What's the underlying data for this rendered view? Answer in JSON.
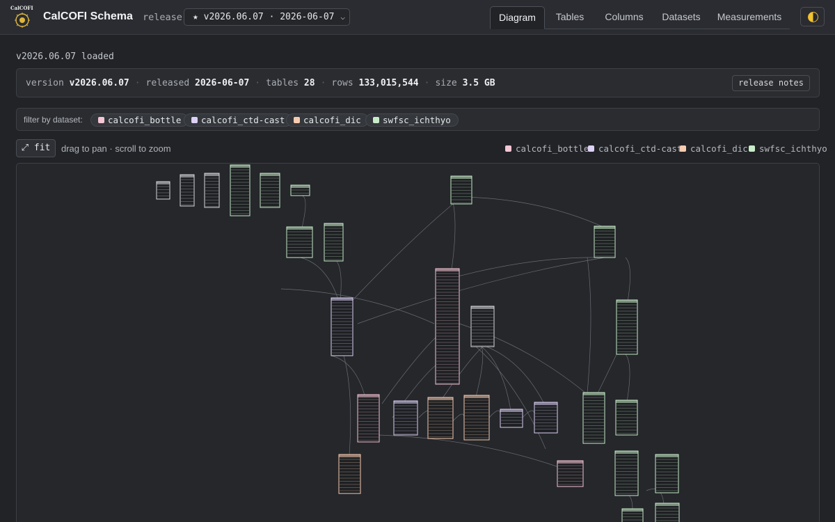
{
  "header": {
    "logo_text": "CalCOFI",
    "title": "CalCOFI Schema",
    "release_label": "release",
    "release_selected": "★ v2026.06.07 · 2026-06-07",
    "tabs": [
      "Diagram",
      "Tables",
      "Columns",
      "Datasets",
      "Measurements"
    ],
    "active_tab": "Diagram"
  },
  "status": "v2026.06.07 loaded",
  "summary": {
    "version_label": "version",
    "version": "v2026.06.07",
    "released_label": "released",
    "released": "2026-06-07",
    "tables_label": "tables",
    "tables": "28",
    "rows_label": "rows",
    "rows": "133,015,544",
    "size_label": "size",
    "size": "3.5 GB",
    "notes_button": "release notes"
  },
  "filter": {
    "label": "filter by dataset:",
    "datasets": [
      "calcofi_bottle",
      "calcofi_ctd-cast",
      "calcofi_dic",
      "swfsc_ichthyo"
    ]
  },
  "toolbar": {
    "fit_label": "⤢ fit",
    "hint": "drag to pan · scroll to zoom"
  },
  "legend": [
    "calcofi_bottle",
    "calcofi_ctd-cast",
    "calcofi_dic",
    "swfsc_ichthyo"
  ],
  "colors": {
    "calcofi_bottle": "#f5c6d4",
    "calcofi_ctd-cast": "#ddd0f5",
    "calcofi_dic": "#f8cbb0",
    "swfsc_ichthyo": "#c8ecc8",
    "neutral": "#d8dade",
    "accent": "#f4c430"
  }
}
